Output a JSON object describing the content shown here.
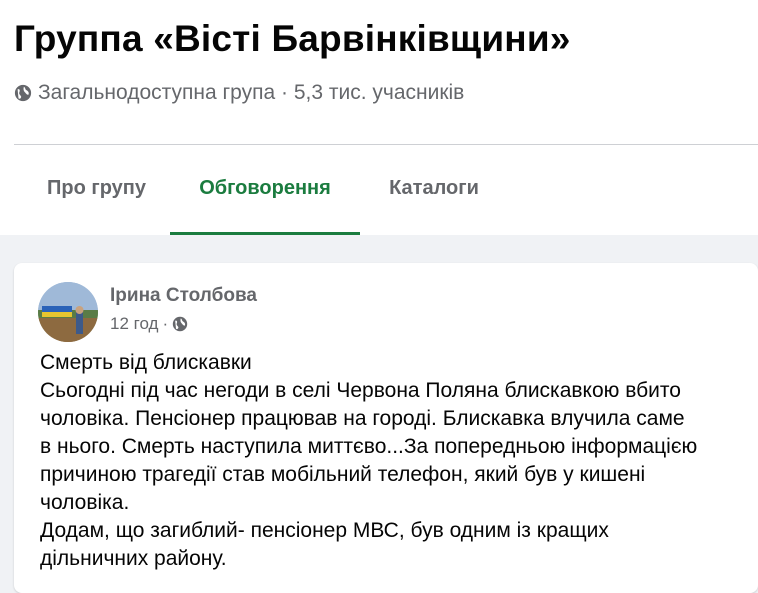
{
  "group": {
    "title": "Группа «Вісті Барвінківщини»",
    "meta": "Загальнодоступна група · 5,3 тис. учасників"
  },
  "tabs": [
    {
      "label": "Про групу",
      "active": false
    },
    {
      "label": "Обговорення",
      "active": true
    },
    {
      "label": "Каталоги",
      "active": false
    }
  ],
  "post": {
    "author": "Ірина Столбова",
    "time": "12 год",
    "separator": "·",
    "lines": [
      "Смерть від блискавки",
      "Сьогодні під час негоди в селі Червона Поляна блискавкою вбито",
      "чоловіка. Пенсіонер працював на городі.  Блискавка влучила саме",
      "в нього. Смерть наступила миттєво...За попередньою інформацією",
      "причиною трагедії  став мобільний телефон, який був у кишені",
      "чоловіка.",
      "Додам, що загиблий- пенсіонер МВС, був одним із кращих",
      "дільничних району."
    ]
  },
  "colors": {
    "accent": "#1b7c3f",
    "secondary_text": "#65676b",
    "primary_text": "#050505",
    "page_background": "#f0f2f5"
  }
}
